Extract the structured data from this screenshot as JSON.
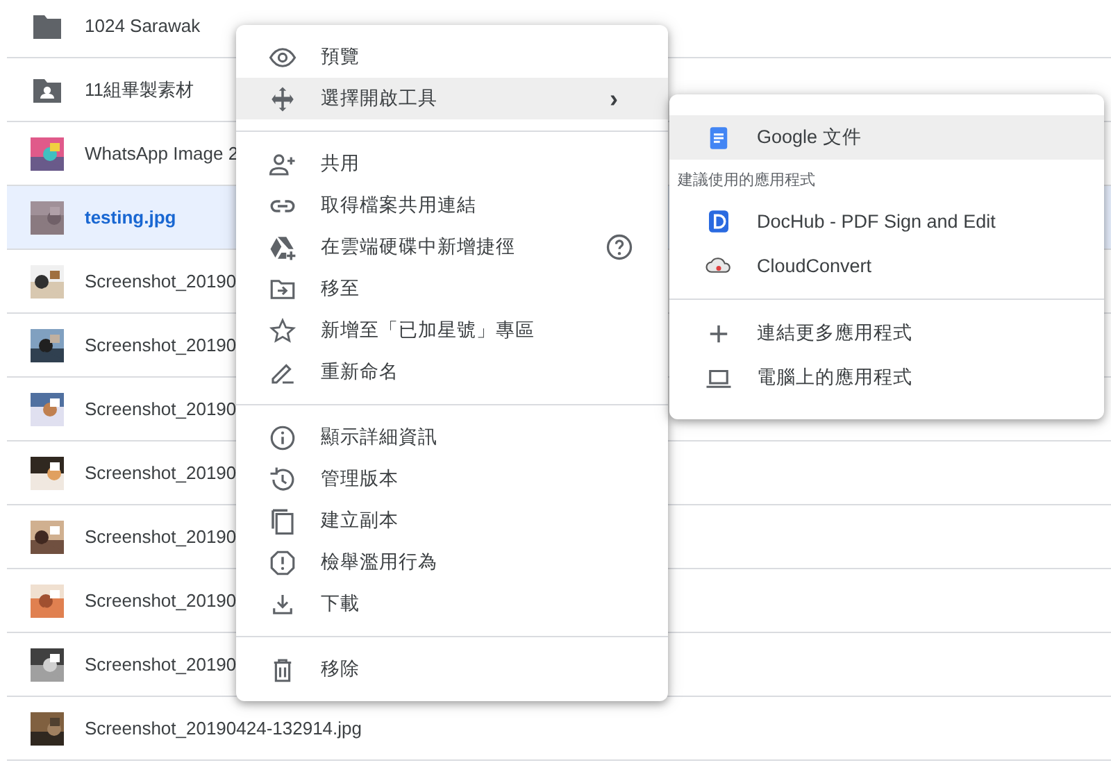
{
  "files": [
    {
      "name": "1024 Sarawak",
      "kind": "folder",
      "selected": false
    },
    {
      "name": "11組畢製素材",
      "kind": "shared_folder",
      "selected": false
    },
    {
      "name": "WhatsApp Image 2",
      "selected": false
    },
    {
      "name": "testing.jpg",
      "selected": true
    },
    {
      "name": "Screenshot_20190",
      "selected": false
    },
    {
      "name": "Screenshot_20190",
      "selected": false
    },
    {
      "name": "Screenshot_20190",
      "selected": false
    },
    {
      "name": "Screenshot_20190",
      "selected": false
    },
    {
      "name": "Screenshot_20190",
      "selected": false
    },
    {
      "name": "Screenshot_20190",
      "selected": false
    },
    {
      "name": "Screenshot_20190",
      "selected": false
    },
    {
      "name": "Screenshot_20190424-132914.jpg",
      "selected": false
    }
  ],
  "context_menu": {
    "sections": [
      [
        {
          "label": "預覽",
          "selected": false
        },
        {
          "label": "選擇開啟工具",
          "selected": true,
          "submenu_arrow": "›"
        }
      ],
      [
        {
          "label": "共用",
          "selected": false
        },
        {
          "label": "取得檔案共用連結",
          "selected": false
        },
        {
          "label": "在雲端硬碟中新增捷徑",
          "selected": false,
          "help": true
        },
        {
          "label": "移至",
          "selected": false
        },
        {
          "label": "新增至「已加星號」專區",
          "selected": false
        },
        {
          "label": "重新命名",
          "selected": false
        }
      ],
      [
        {
          "label": "顯示詳細資訊",
          "selected": false
        },
        {
          "label": "管理版本",
          "selected": false
        },
        {
          "label": "建立副本",
          "selected": false
        },
        {
          "label": "檢舉濫用行為",
          "selected": false
        },
        {
          "label": "下載",
          "selected": false
        }
      ],
      [
        {
          "label": "移除",
          "selected": false
        }
      ]
    ]
  },
  "open_with_menu": {
    "sections": [
      {
        "items": [
          {
            "label": "Google 文件",
            "selected": true
          }
        ]
      },
      {
        "heading": "建議使用的應用程式",
        "items": [
          {
            "label": "DocHub - PDF Sign and Edit",
            "selected": false
          },
          {
            "label": "CloudConvert",
            "selected": false
          }
        ]
      },
      {
        "items": [
          {
            "label": "連結更多應用程式",
            "selected": false
          },
          {
            "label": "電腦上的應用程式",
            "selected": false
          }
        ]
      }
    ]
  }
}
